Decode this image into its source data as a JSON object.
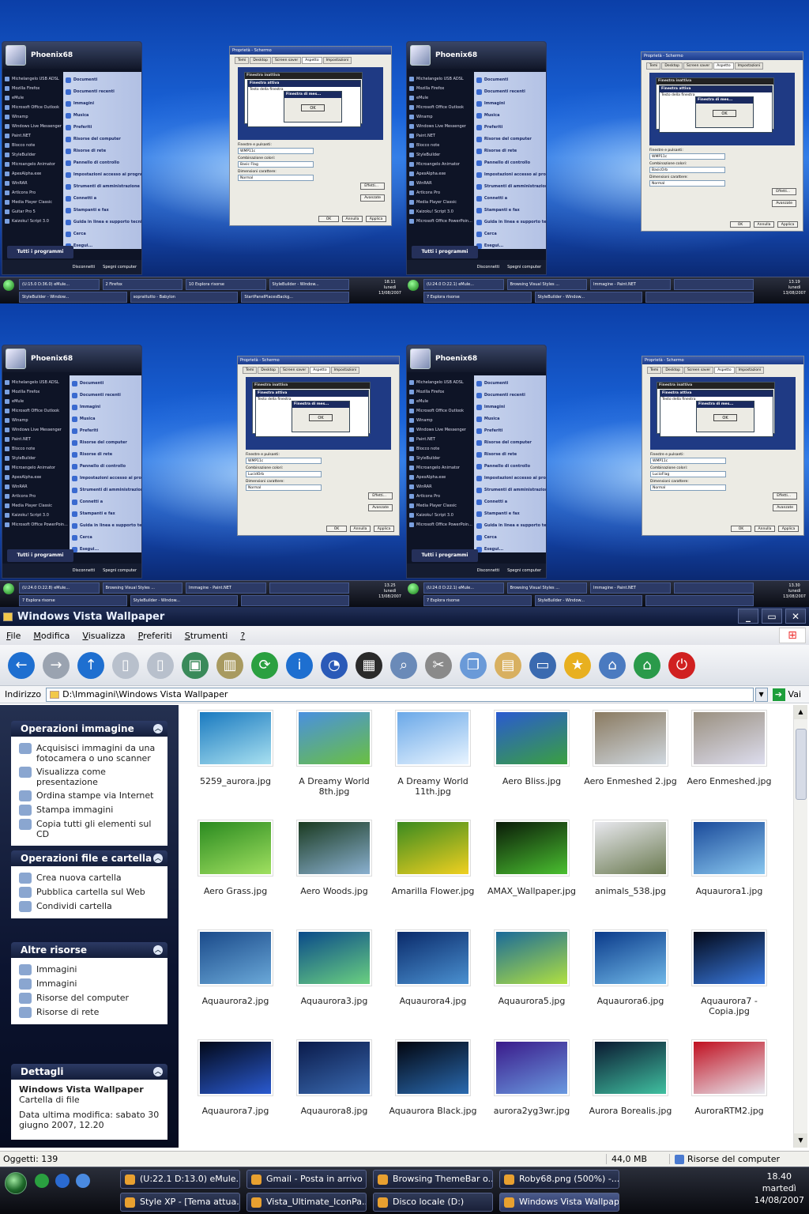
{
  "thumbs": [
    {
      "user": "Phoenix68",
      "all_programs": "Tutti i programmi",
      "logoff": "Disconnetti",
      "shutdown": "Spegni computer",
      "left_items": [
        "Michelangelo USB ADSL",
        "Mozilla Firefox",
        "eMule",
        "Microsoft Office Outlook",
        "Winamp",
        "Windows Live Messenger",
        "Paint.NET",
        "Blocco note",
        "StyleBuilder",
        "Microangelo Animator",
        "ApexAlpha.exe",
        "WinRAR",
        "ArtIcons Pro",
        "Media Player Classic",
        "Guitar Pro 5",
        "Kaizoku! Script 3.0"
      ],
      "right_items": [
        "Documenti",
        "Documenti recenti",
        "Immagini",
        "Musica",
        "Preferiti",
        "Risorse del computer",
        "Risorse di rete",
        "Pannello di controllo",
        "Impostazioni accesso ai programmi",
        "Strumenti di amministrazione",
        "Connetti a",
        "Stampanti e fax",
        "Guida in linea e supporto tecnico",
        "Cerca",
        "Esegui..."
      ],
      "dialog": {
        "title": "Proprietà - Schermo",
        "tabs": [
          "Temi",
          "Desktop",
          "Screen saver",
          "Aspetto",
          "Impostazioni"
        ],
        "inactive": "Finestra inattiva",
        "active": "Finestra attiva",
        "text": "Testo della finestra",
        "msgbox": "Finestra di mes...",
        "ok": "OK",
        "l1": "Finestre e pulsanti:",
        "v1": "WMP11c",
        "l2": "Combinazione colori:",
        "v2": "Basic Flag",
        "l3": "Dimensioni carattere:",
        "v3": "Normal",
        "effects": "Effetti...",
        "advanced": "Avanzate",
        "btn_ok": "OK",
        "btn_cancel": "Annulla",
        "btn_apply": "Applica"
      },
      "tasks": [
        "(U:15.0 D:36.0) eMule...",
        "2 Firefox",
        "10 Esplora risorse",
        "StyleBuilder - Window...",
        "StyleBuilder - Window...",
        "soprattutto - Babylon",
        "StartPanelPlacesBackg..."
      ],
      "time": "18.11",
      "day": "lunedì",
      "date": "13/08/2007"
    },
    {
      "user": "Phoenix68",
      "all_programs": "Tutti i programmi",
      "logoff": "Disconnetti",
      "shutdown": "Spegni computer",
      "left_items": [
        "Michelangelo USB ADSL",
        "Mozilla Firefox",
        "eMule",
        "Microsoft Office Outlook",
        "Winamp",
        "Windows Live Messenger",
        "Paint.NET",
        "Blocco note",
        "StyleBuilder",
        "Microangelo Animator",
        "ApexAlpha.exe",
        "WinRAR",
        "ArtIcons Pro",
        "Media Player Classic",
        "Kaizoku! Script 3.0",
        "Microsoft Office PowerPoin..."
      ],
      "right_items": [
        "Documenti",
        "Documenti recenti",
        "Immagini",
        "Musica",
        "Preferiti",
        "Risorse del computer",
        "Risorse di rete",
        "Pannello di controllo",
        "Impostazioni accesso ai programmi",
        "Strumenti di amministrazione",
        "Connetti a",
        "Stampanti e fax",
        "Guida in linea e supporto tecnico",
        "Cerca",
        "Esegui..."
      ],
      "dialog": {
        "title": "Proprietà - Schermo",
        "tabs": [
          "Temi",
          "Desktop",
          "Screen saver",
          "Aspetto",
          "Impostazioni"
        ],
        "inactive": "Finestra inattiva",
        "active": "Finestra attiva",
        "text": "Testo della finestra",
        "msgbox": "Finestra di mes...",
        "ok": "OK",
        "l1": "Finestre e pulsanti:",
        "v1": "WMP11c",
        "l2": "Combinazione colori:",
        "v2": "BasicOrb",
        "l3": "Dimensioni carattere:",
        "v3": "Normal",
        "effects": "Effetti...",
        "advanced": "Avanzate",
        "btn_ok": "OK",
        "btn_cancel": "Annulla",
        "btn_apply": "Applica"
      },
      "tasks": [
        "(U:24.0 D:22.1) eMule...",
        "Browsing Visual Styles ...",
        "Immagine - Paint.NET",
        "",
        "7 Esplora risorse",
        "StyleBuilder - Window...",
        ""
      ],
      "time": "13.19",
      "day": "lunedì",
      "date": "13/08/2007"
    },
    {
      "user": "Phoenix68",
      "all_programs": "Tutti i programmi",
      "logoff": "Disconnetti",
      "shutdown": "Spegni computer",
      "left_items": [
        "Michelangelo USB ADSL",
        "Mozilla Firefox",
        "eMule",
        "Microsoft Office Outlook",
        "Winamp",
        "Windows Live Messenger",
        "Paint.NET",
        "Blocco note",
        "StyleBuilder",
        "Microangelo Animator",
        "ApexAlpha.exe",
        "WinRAR",
        "ArtIcons Pro",
        "Media Player Classic",
        "Kaizoku! Script 3.0",
        "Microsoft Office PowerPoin..."
      ],
      "right_items": [
        "Documenti",
        "Documenti recenti",
        "Immagini",
        "Musica",
        "Preferiti",
        "Risorse del computer",
        "Risorse di rete",
        "Pannello di controllo",
        "Impostazioni accesso ai programmi",
        "Strumenti di amministrazione",
        "Connetti a",
        "Stampanti e fax",
        "Guida in linea e supporto tecnico",
        "Cerca",
        "Esegui..."
      ],
      "dialog": {
        "title": "Proprietà - Schermo",
        "tabs": [
          "Temi",
          "Desktop",
          "Screen saver",
          "Aspetto",
          "Impostazioni"
        ],
        "inactive": "Finestra inattiva",
        "active": "Finestra attiva",
        "text": "Testo della finestra",
        "msgbox": "Finestra di mes...",
        "ok": "OK",
        "l1": "Finestre e pulsanti:",
        "v1": "WMP11c",
        "l2": "Combinazione colori:",
        "v2": "LucidOrb",
        "l3": "Dimensioni carattere:",
        "v3": "Normal",
        "effects": "Effetti...",
        "advanced": "Avanzate",
        "btn_ok": "OK",
        "btn_cancel": "Annulla",
        "btn_apply": "Applica"
      },
      "tasks": [
        "(U:24.0 D:22.8) eMule...",
        "Browsing Visual Styles ...",
        "Immagine - Paint.NET",
        "",
        "7 Esplora risorse",
        "StyleBuilder - Window...",
        ""
      ],
      "time": "13.25",
      "day": "lunedì",
      "date": "13/08/2007"
    },
    {
      "user": "Phoenix68",
      "all_programs": "Tutti i programmi",
      "logoff": "Disconnetti",
      "shutdown": "Spegni computer",
      "left_items": [
        "Michelangelo USB ADSL",
        "Mozilla Firefox",
        "eMule",
        "Microsoft Office Outlook",
        "Winamp",
        "Windows Live Messenger",
        "Paint.NET",
        "Blocco note",
        "StyleBuilder",
        "Microangelo Animator",
        "ApexAlpha.exe",
        "WinRAR",
        "ArtIcons Pro",
        "Media Player Classic",
        "Kaizoku! Script 3.0",
        "Microsoft Office PowerPoin..."
      ],
      "right_items": [
        "Documenti",
        "Documenti recenti",
        "Immagini",
        "Musica",
        "Preferiti",
        "Risorse del computer",
        "Risorse di rete",
        "Pannello di controllo",
        "Impostazioni accesso ai programmi",
        "Strumenti di amministrazione",
        "Connetti a",
        "Stampanti e fax",
        "Guida in linea e supporto tecnico",
        "Cerca",
        "Esegui..."
      ],
      "dialog": {
        "title": "Proprietà - Schermo",
        "tabs": [
          "Temi",
          "Desktop",
          "Screen saver",
          "Aspetto",
          "Impostazioni"
        ],
        "inactive": "Finestra inattiva",
        "active": "Finestra attiva",
        "text": "Testo della finestra",
        "msgbox": "Finestra di mes...",
        "ok": "OK",
        "l1": "Finestre e pulsanti:",
        "v1": "WMP11c",
        "l2": "Combinazione colori:",
        "v2": "LucioFlag",
        "l3": "Dimensioni carattere:",
        "v3": "Normal",
        "effects": "Effetti...",
        "advanced": "Avanzate",
        "btn_ok": "OK",
        "btn_cancel": "Annulla",
        "btn_apply": "Applica"
      },
      "tasks": [
        "(U:24.0 D:22.1) eMule...",
        "Browsing Visual Styles ...",
        "Immagine - Paint.NET",
        "",
        "7 Esplora risorse",
        "StyleBuilder - Window...",
        ""
      ],
      "time": "13.30",
      "day": "lunedì",
      "date": "13/08/2007"
    }
  ],
  "explorer": {
    "title": "Windows Vista Wallpaper",
    "window_buttons": [
      "_",
      "▭",
      "✕"
    ],
    "menu": [
      {
        "key": "F",
        "rest": "ile"
      },
      {
        "key": "M",
        "rest": "odifica"
      },
      {
        "key": "V",
        "rest": "isualizza"
      },
      {
        "key": "P",
        "rest": "referiti"
      },
      {
        "key": "S",
        "rest": "trumenti"
      },
      {
        "key": "?",
        "rest": ""
      }
    ],
    "toolbar_icons": [
      {
        "name": "back-icon",
        "glyph": "←",
        "color": "#1e6fd0"
      },
      {
        "name": "forward-icon",
        "glyph": "→",
        "color": "#9aa3b0"
      },
      {
        "name": "up-icon",
        "glyph": "↑",
        "color": "#1e6fd0"
      },
      {
        "name": "copy-to-icon",
        "glyph": "▯",
        "color": "#b8c0cc"
      },
      {
        "name": "move-to-icon",
        "glyph": "▯",
        "color": "#b8c0cc"
      },
      {
        "name": "network-drive-icon",
        "glyph": "▣",
        "color": "#3a8a5a"
      },
      {
        "name": "folders-icon",
        "glyph": "▥",
        "color": "#a89a60"
      },
      {
        "name": "refresh-icon",
        "glyph": "⟳",
        "color": "#2aa040"
      },
      {
        "name": "info-icon",
        "glyph": "i",
        "color": "#1e6fd0"
      },
      {
        "name": "clock-icon",
        "glyph": "◔",
        "color": "#2a5ab8"
      },
      {
        "name": "views-icon",
        "glyph": "▦",
        "color": "#2a2a2a"
      },
      {
        "name": "search-icon",
        "glyph": "⌕",
        "color": "#6a8ab8"
      },
      {
        "name": "cut-icon",
        "glyph": "✂",
        "color": "#8a8a8a"
      },
      {
        "name": "copy-icon",
        "glyph": "❐",
        "color": "#6a9ad8"
      },
      {
        "name": "paste-icon",
        "glyph": "▤",
        "color": "#d8b060"
      },
      {
        "name": "monitor-icon",
        "glyph": "▭",
        "color": "#3a6ab0"
      },
      {
        "name": "favorites-icon",
        "glyph": "★",
        "color": "#e8b020"
      },
      {
        "name": "network-icon",
        "glyph": "⌂",
        "color": "#4a7ac0"
      },
      {
        "name": "home-icon",
        "glyph": "⌂",
        "color": "#2a9a4a"
      },
      {
        "name": "power-icon",
        "glyph": "⏻",
        "color": "#d02020"
      }
    ],
    "address_label": "Indirizzo",
    "address": "D:\\Immagini\\Windows Vista Wallpaper",
    "go_label": "Vai",
    "panels": [
      {
        "title": "Operazioni immagine",
        "items": [
          "Acquisisci immagini da una fotocamera o uno scanner",
          "Visualizza come presentazione",
          "Ordina stampe via Internet",
          "Stampa immagini",
          "Copia tutti gli elementi sul CD"
        ]
      },
      {
        "title": "Operazioni file e cartella",
        "items": [
          "Crea nuova cartella",
          "Pubblica cartella sul Web",
          "Condividi cartella"
        ]
      },
      {
        "title": "Altre risorse",
        "items": [
          "Immagini",
          "Immagini",
          "Risorse del computer",
          "Risorse di rete"
        ]
      }
    ],
    "details": {
      "title": "Dettagli",
      "name": "Windows Vista Wallpaper",
      "type": "Cartella di file",
      "modified": "Data ultima modifica: sabato 30 giugno 2007, 12.20"
    },
    "files": [
      {
        "name": "5259_aurora.jpg",
        "c1": "#1a7ac0",
        "c2": "#a8e0f0"
      },
      {
        "name": "A Dreamy World 8th.jpg",
        "c1": "#4a90e0",
        "c2": "#6ac040"
      },
      {
        "name": "A Dreamy World 11th.jpg",
        "c1": "#6aa8e8",
        "c2": "#e8f4ff"
      },
      {
        "name": "Aero Bliss.jpg",
        "c1": "#2a5ad0",
        "c2": "#3aa040"
      },
      {
        "name": "Aero Enmeshed 2.jpg",
        "c1": "#8a7a60",
        "c2": "#d0d8e0"
      },
      {
        "name": "Aero Enmeshed.jpg",
        "c1": "#9a9080",
        "c2": "#dde"
      },
      {
        "name": "Aero Grass.jpg",
        "c1": "#2a8a20",
        "c2": "#a0e060"
      },
      {
        "name": "Aero Woods.jpg",
        "c1": "#1a3a20",
        "c2": "#8ab0d0"
      },
      {
        "name": "Amarilla Flower.jpg",
        "c1": "#3a8a20",
        "c2": "#f0d020"
      },
      {
        "name": "AMAX_Wallpaper.jpg",
        "c1": "#0a1a08",
        "c2": "#4ac030"
      },
      {
        "name": "animals_538.jpg",
        "c1": "#e8e8ee",
        "c2": "#6a7a50"
      },
      {
        "name": "Aquaurora1.jpg",
        "c1": "#1a4a9a",
        "c2": "#8ac8f0"
      },
      {
        "name": "Aquaurora2.jpg",
        "c1": "#1a4a8a",
        "c2": "#6aa8d8"
      },
      {
        "name": "Aquaurora3.jpg",
        "c1": "#0a4a8a",
        "c2": "#6ad080"
      },
      {
        "name": "Aquaurora4.jpg",
        "c1": "#0a2a6a",
        "c2": "#4a90d0"
      },
      {
        "name": "Aquaurora5.jpg",
        "c1": "#1a6a9a",
        "c2": "#b0e040"
      },
      {
        "name": "Aquaurora6.jpg",
        "c1": "#0a3a8a",
        "c2": "#70b8e8"
      },
      {
        "name": "Aquaurora7 - Copia.jpg",
        "c1": "#020818",
        "c2": "#3a7ae0"
      },
      {
        "name": "Aquaurora7.jpg",
        "c1": "#020818",
        "c2": "#2a5ad0"
      },
      {
        "name": "Aquaurora8.jpg",
        "c1": "#0a1a4a",
        "c2": "#3a6ab0"
      },
      {
        "name": "Aquaurora Black.jpg",
        "c1": "#02050e",
        "c2": "#2a6ab0"
      },
      {
        "name": "aurora2yg3wr.jpg",
        "c1": "#3a1a8a",
        "c2": "#6a9ae0"
      },
      {
        "name": "Aurora Borealis.jpg",
        "c1": "#0a1830",
        "c2": "#40c0a0"
      },
      {
        "name": "AuroraRTM2.jpg",
        "c1": "#c01020",
        "c2": "#e8e8f0"
      }
    ],
    "status_objects": "Oggetti: 139",
    "status_size": "44,0 MB",
    "status_location": "Risorse del computer"
  },
  "taskbar": {
    "buttons": [
      "(U:22.1 D:13.0) eMule...",
      "Gmail - Posta in arrivo ...",
      "Browsing ThemeBar o...",
      "Roby68.png (500%) -...",
      "Style XP - [Tema attua...",
      "Vista_Ultimate_IconPa...",
      "Disco locale  (D:)",
      "Windows Vista Wallpaper"
    ],
    "time": "18.40",
    "day": "martedì",
    "date": "14/08/2007"
  }
}
